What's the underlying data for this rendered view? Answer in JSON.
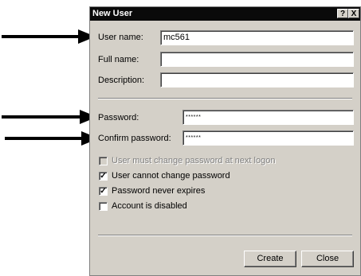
{
  "window": {
    "title": "New User",
    "help_glyph": "?",
    "close_glyph": "X"
  },
  "fields": {
    "user_name": {
      "label": "User name:",
      "value": "mc561"
    },
    "full_name": {
      "label": "Full name:",
      "value": ""
    },
    "description": {
      "label": "Description:",
      "value": ""
    },
    "password": {
      "label": "Password:",
      "value": "******"
    },
    "confirm_password": {
      "label": "Confirm password:",
      "value": "******"
    }
  },
  "options": [
    {
      "label": "User must change password at next logon",
      "checked": false,
      "enabled": false
    },
    {
      "label": "User cannot change password",
      "checked": true,
      "enabled": true
    },
    {
      "label": "Password never expires",
      "checked": true,
      "enabled": true
    },
    {
      "label": "Account is disabled",
      "checked": false,
      "enabled": true
    }
  ],
  "buttons": {
    "create": "Create",
    "close": "Close"
  },
  "annotations": {
    "arrow_color": "#000000"
  }
}
